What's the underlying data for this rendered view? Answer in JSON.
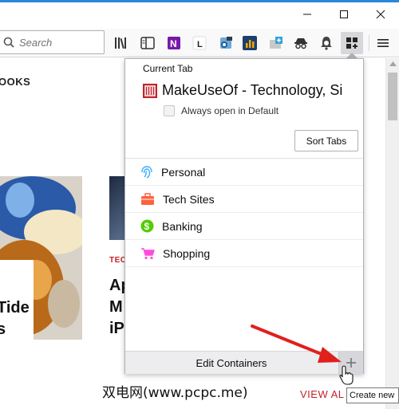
{
  "toolbar": {
    "search_placeholder": "Search",
    "menu_icon": "hamburger-menu-icon"
  },
  "page": {
    "books_heading": "OOKS",
    "tech_label": "TEC",
    "headline_right": [
      "Ap",
      "M",
      "iP"
    ],
    "headline_left": [
      "Tide",
      "s"
    ],
    "watermark": "双电网(www.pcpc.me)",
    "view_all": "VIEW AL"
  },
  "panel": {
    "current_tab_heading": "Current Tab",
    "site_title": "MakeUseOf - Technology, Si",
    "always_open_label": "Always open in Default",
    "sort_tabs_label": "Sort Tabs",
    "containers": [
      {
        "label": "Personal",
        "icon": "fingerprint-icon",
        "color": "#37adff"
      },
      {
        "label": "Tech Sites",
        "icon": "briefcase-icon",
        "color": "#ff613d"
      },
      {
        "label": "Banking",
        "icon": "dollar-icon",
        "color": "#51cd00"
      },
      {
        "label": "Shopping",
        "icon": "cart-icon",
        "color": "#ff4bda"
      }
    ],
    "edit_containers_label": "Edit Containers",
    "add_icon": "plus-icon"
  },
  "tooltip": {
    "text": "Create new"
  },
  "colors": {
    "accent": "#2b88d8",
    "site_brand": "#c4222a",
    "annotation_arrow": "#e0201d"
  }
}
